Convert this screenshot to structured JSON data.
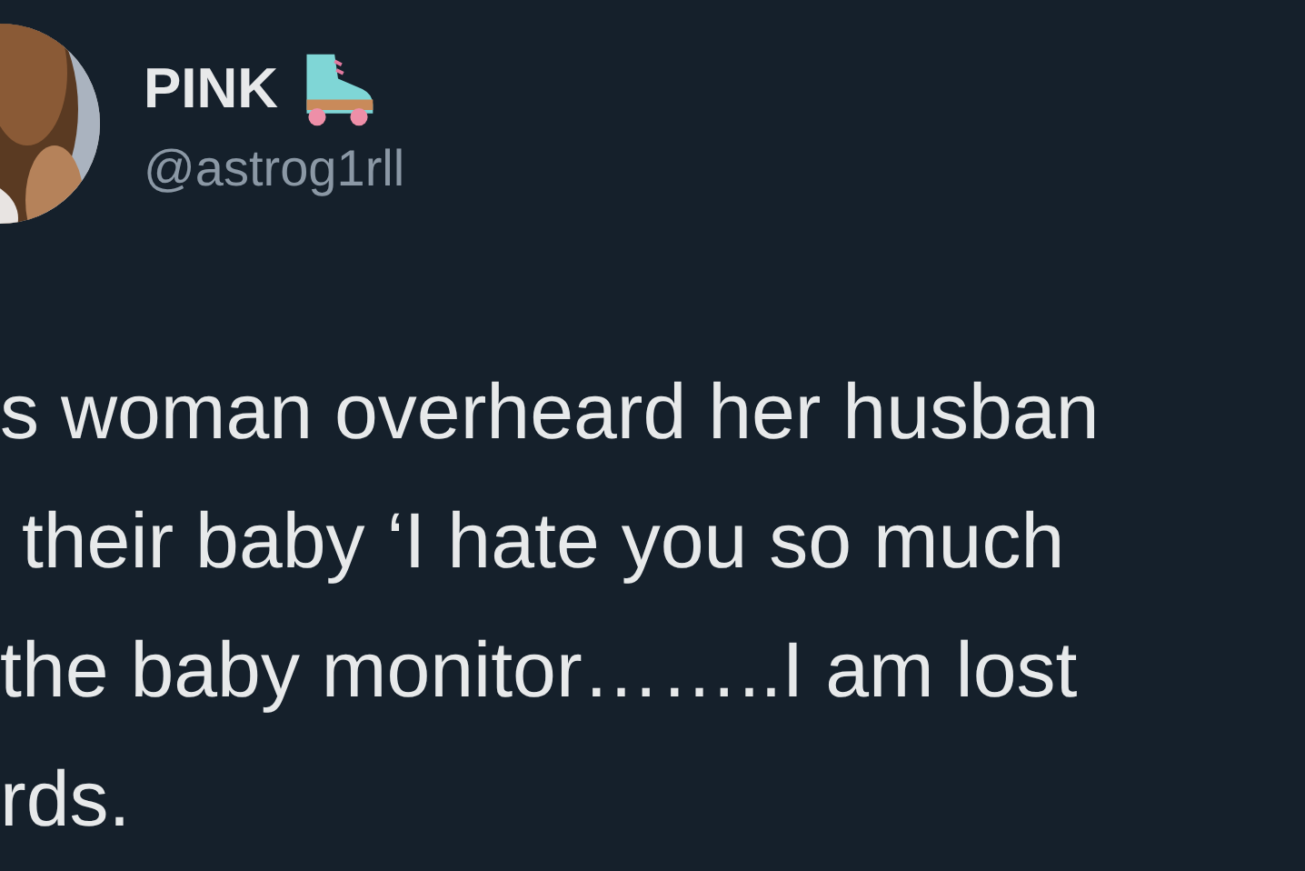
{
  "author": {
    "name": "PINK",
    "handle": "@astrog1rll"
  },
  "tweet_lines": [
    "s woman overheard her husban",
    " their baby ‘I hate you so much",
    "the baby monitor……..I am lost",
    "rds."
  ]
}
